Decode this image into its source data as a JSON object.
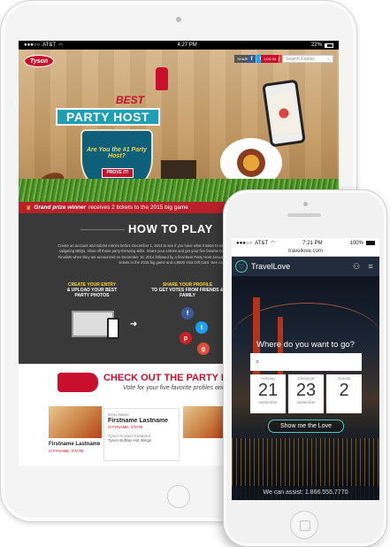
{
  "ipad": {
    "status": {
      "carrier": "AT&T",
      "time": "4:27 PM",
      "battery": "22%"
    },
    "tyson": {
      "logo": "Tyson",
      "header": {
        "share_label": "SHARE",
        "login_label": "LOG IN",
        "search_placeholder": "Search Entries"
      },
      "hero": {
        "best": "BEST",
        "title": "PARTY HOST",
        "question": "Are You the #1 Party Host?",
        "cta": "PROVE IT!"
      },
      "grand_prize": {
        "lead": "Grand prize winner",
        "text": "receives 2 tickets to the 2015 big game"
      },
      "howto": {
        "title": "HOW TO PLAY",
        "body": "Create an account and submit entries before December 1, 2014 to see if you have what it takes to earn the Best Party Host title. From cocktail hours to tailgating BBQs, show off those party-throwing skills. Share your entries and get your five favorite hosts once a day. Be sure to check out the Top Ten Finalists when they are announced on December 15, 2014 followed by a final Best Party Host January 1, 2015. Winners could score a grand prize of 2 tickets to the 2015 big game and a $500 Visa Gift Card. See complete rules.",
        "step1": {
          "title": "CREATE YOUR ENTRY",
          "sub": "& UPLOAD YOUR BEST PARTY PHOTOS"
        },
        "step2": {
          "title": "SHARE YOUR PROFILE",
          "sub": "TO GET VOTES FROM FRIENDS & FAMILY"
        }
      },
      "party": {
        "title": "CHECK OUT THE PARTY HO",
        "subtitle": "Vote for your five favorite profiles onc",
        "entry_label": "Entry Name",
        "entry_name": "Firstname Lastname",
        "entry_location": "CITYNAME, STATE",
        "product_label": "Tyson Product Featured",
        "product_name": "Tyson Buffalo Hot Wings",
        "card_name": "Firstname Lastname",
        "card_location": "CITYNAME, STATE"
      }
    }
  },
  "iphone": {
    "status": {
      "carrier": "AT&T",
      "time": "7:21 PM",
      "battery": "100%"
    },
    "url": "travellove.com",
    "app": {
      "name": "TravelLove",
      "question": "Where do you want to go?",
      "dates": [
        {
          "label": "Arriving",
          "value": "21",
          "month": "september"
        },
        {
          "label": "Checkout",
          "value": "23",
          "month": "september"
        },
        {
          "label": "Guests",
          "value": "2",
          "month": ""
        }
      ],
      "cta": "Show me the Love",
      "footer": "We can assist: 1.866.555.7770"
    }
  },
  "colors": {
    "tyson_red": "#c8102e",
    "travellove_teal": "#4bc9c2",
    "banner_blue": "#1e9fb5"
  },
  "icons": [
    "facebook-icon",
    "twitter-icon",
    "pinterest-icon",
    "google-plus-icon",
    "search-icon",
    "wifi-icon",
    "battery-icon",
    "user-icon",
    "menu-icon",
    "crown-icon",
    "arrow-icon"
  ]
}
